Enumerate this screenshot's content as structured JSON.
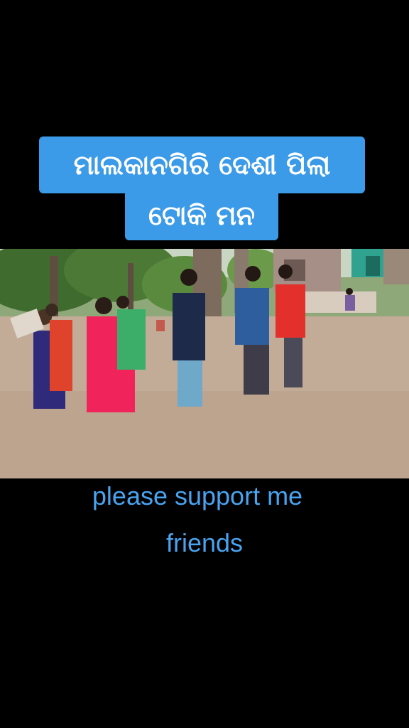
{
  "overlay_caption": {
    "line1": "ମାଲକାନଗିରି ଦେଶୀ ପିଲା",
    "line2": "ଟୋକି ମନ",
    "background_color": "#3b9be8"
  },
  "video": {
    "scene": "video-frame"
  },
  "support_message": {
    "line1": "please support me",
    "line2": "friends",
    "color": "#4aa3ef"
  }
}
